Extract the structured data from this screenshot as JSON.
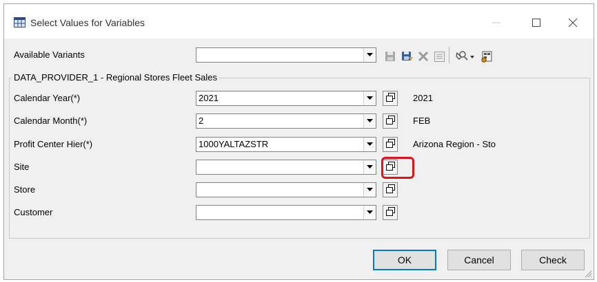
{
  "window": {
    "title": "Select Values for Variables"
  },
  "variants": {
    "label": "Available Variants",
    "value": ""
  },
  "toolbar": {
    "icons": [
      "save-icon",
      "save-as-icon",
      "delete-icon",
      "details-icon",
      "personalize-icon",
      "settings-icon"
    ]
  },
  "group": {
    "title": "DATA_PROVIDER_1 - Regional Stores Fleet Sales"
  },
  "rows": [
    {
      "label": "Calendar Year(*)",
      "value": "2021",
      "desc": "2021"
    },
    {
      "label": "Calendar Month(*)",
      "value": "2",
      "desc": "FEB"
    },
    {
      "label": "Profit Center Hier(*)",
      "value": "1000YALTAZSTR",
      "desc": "Arizona Region - Sto"
    },
    {
      "label": "Site",
      "value": "",
      "desc": ""
    },
    {
      "label": "Store",
      "value": "",
      "desc": ""
    },
    {
      "label": "Customer",
      "value": "",
      "desc": ""
    }
  ],
  "buttons": {
    "ok": "OK",
    "cancel": "Cancel",
    "check": "Check"
  },
  "colors": {
    "highlight": "#e0121c",
    "focus_border": "#0078d7"
  }
}
